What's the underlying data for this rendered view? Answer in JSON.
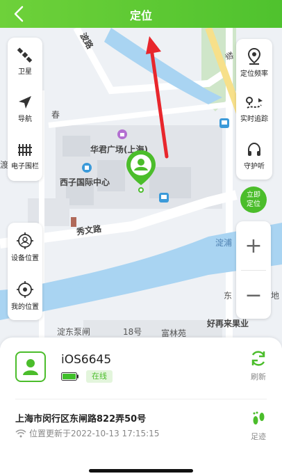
{
  "header": {
    "title": "定位"
  },
  "map": {
    "labels": {
      "road_bo": "波路",
      "road_li": "黎",
      "chun": "春",
      "huajun_plaza": "华君广场(上海)",
      "xizi_center": "西子国际中心",
      "xiuwen_road": "秀文路",
      "dian": "淀浦",
      "dong": "东",
      "di": "地",
      "pier": "淀东泵闸",
      "no18": "18号",
      "fulinyuan": "富林苑",
      "haoyoulai": "好再来果业",
      "zhi": "渡"
    }
  },
  "left_panel_top": [
    {
      "label": "卫星",
      "icon": "satellite-icon"
    },
    {
      "label": "导航",
      "icon": "navigation-icon"
    },
    {
      "label": "电子围栏",
      "icon": "fence-icon"
    }
  ],
  "left_panel_bottom": [
    {
      "label": "设备位置",
      "icon": "device-location-icon"
    },
    {
      "label": "我的位置",
      "icon": "my-location-icon"
    }
  ],
  "right_panel_top": [
    {
      "label": "定位频率",
      "icon": "location-frequency-icon"
    },
    {
      "label": "实时追踪",
      "icon": "realtime-tracking-icon"
    },
    {
      "label": "守护听",
      "icon": "headphones-icon"
    }
  ],
  "locate_now": {
    "line1": "立即",
    "line2": "定位"
  },
  "zoom": {
    "in": "+",
    "out": "−"
  },
  "sheet": {
    "device_name": "iOS6645",
    "status": "在线",
    "refresh_label": "刷新",
    "address": "上海市闵行区东闸路822弄50号",
    "update_text": "位置更新于2022-10-13 17:15:15",
    "footprint_label": "足迹"
  },
  "colors": {
    "accent": "#4bbd2b",
    "header": "#5cc934",
    "arrow": "#e8262c"
  }
}
